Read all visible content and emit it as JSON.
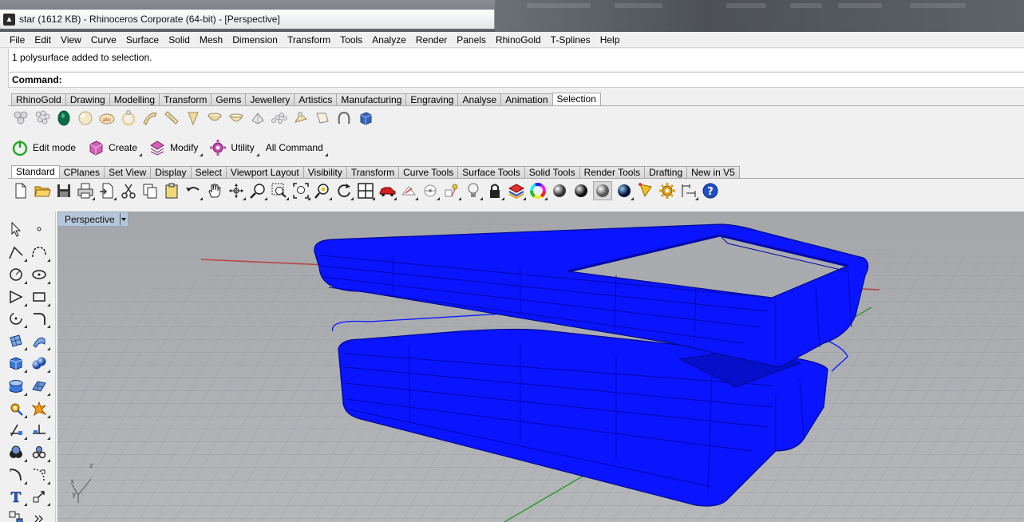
{
  "window": {
    "title": "star (1612 KB) - Rhinoceros Corporate (64-bit) - [Perspective]"
  },
  "menu": [
    "File",
    "Edit",
    "View",
    "Curve",
    "Surface",
    "Solid",
    "Mesh",
    "Dimension",
    "Transform",
    "Tools",
    "Analyze",
    "Render",
    "Panels",
    "RhinoGold",
    "T-Splines",
    "Help"
  ],
  "command": {
    "history": "1 polysurface added to selection.",
    "prompt_label": "Command:",
    "value": ""
  },
  "rhinogold_tabs": {
    "items": [
      "RhinoGold",
      "Drawing",
      "Modelling",
      "Transform",
      "Gems",
      "Jewellery",
      "Artistics",
      "Manufacturing",
      "Engraving",
      "Analyse",
      "Animation",
      "Selection"
    ],
    "active": "Selection"
  },
  "rhinogold_icons": [
    "gem-cluster-icon",
    "gem-pave-icon",
    "green-gem-icon",
    "pearl-icon",
    "bezel-ring-icon",
    "ring-icon",
    "shank-icon",
    "band-icon",
    "prong-icon",
    "cone-icon",
    "bowl-icon",
    "setting-icon",
    "wave-pave-icon",
    "bead-icon",
    "cutter-icon",
    "loop-icon",
    "cube-select-icon"
  ],
  "mode_toolbar": {
    "edit_mode": "Edit mode",
    "create": "Create",
    "modify": "Modify",
    "utility": "Utility",
    "all_command": "All Command"
  },
  "standard_tabs": {
    "items": [
      "Standard",
      "CPlanes",
      "Set View",
      "Display",
      "Select",
      "Viewport Layout",
      "Visibility",
      "Transform",
      "Curve Tools",
      "Surface Tools",
      "Solid Tools",
      "Render Tools",
      "Drafting",
      "New in V5"
    ],
    "active": "Standard"
  },
  "standard_icons": [
    "new-file-icon",
    "open-folder-icon",
    "save-icon",
    "print-icon",
    "import-icon",
    "cut-icon",
    "copy-icon",
    "paste-icon",
    "undo-icon",
    "pan-hand-icon",
    "rotate-view-icon",
    "zoom-icon",
    "zoom-window-icon",
    "zoom-extents-icon",
    "zoom-selected-icon",
    "rotate-camera-icon",
    "four-viewports-icon",
    "car-icon",
    "shade-icon",
    "cplane-icon",
    "points-icon",
    "light-icon",
    "lock-icon",
    "layer-icon",
    "color-wheel-icon",
    "sphere-shaded-icon",
    "sphere-rendered-icon",
    "sphere-ghost-icon",
    "sphere-blue-icon",
    "flag-icon",
    "gear-options-icon",
    "dimension-icon",
    "help-icon"
  ],
  "sidebar_icons": [
    [
      "select-arrow-icon",
      "point-icon"
    ],
    [
      "polyline-icon",
      "curve-icon"
    ],
    [
      "circle-icon",
      "ellipse-icon"
    ],
    [
      "polygon-icon",
      "rectangle-icon"
    ],
    [
      "arc-icon",
      "fillet-curve-icon"
    ],
    [
      "surface-icon",
      "loft-icon"
    ],
    [
      "box-icon",
      "sphere-icon"
    ],
    [
      "cylinder-icon",
      "mesh-plane-icon"
    ],
    [
      "transform-gear-icon",
      "explode-icon"
    ],
    [
      "trim-icon",
      "split-icon"
    ],
    [
      "boolean-icon",
      "group-icon"
    ],
    [
      "fillet-icon",
      "chamfer-icon"
    ],
    [
      "text-icon",
      "snap-icon"
    ],
    [
      "grid-snap-icon",
      "more-icon"
    ]
  ],
  "viewport": {
    "label": "Perspective",
    "axis_z": "z",
    "axis_x": "x",
    "axis_y": "y"
  },
  "colors": {
    "selection": "#0a14ff",
    "viewport_bg": "#a9abaf",
    "grid": "#9a9da1",
    "axis_x": "#c24040",
    "axis_y": "#2e9a2e"
  }
}
